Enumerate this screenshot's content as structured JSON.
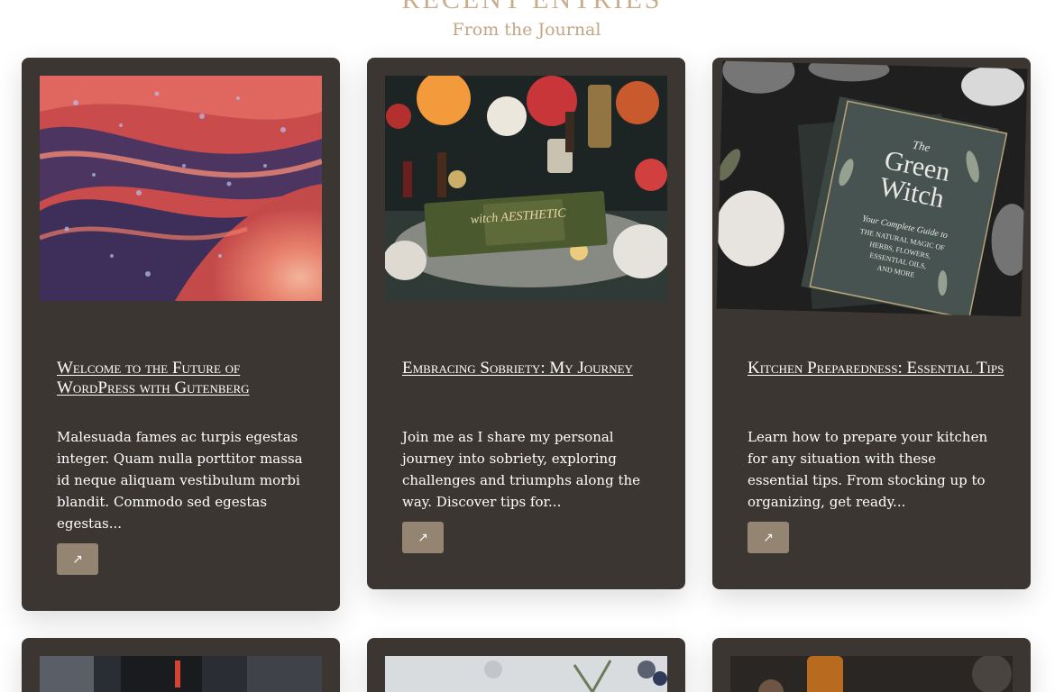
{
  "section": {
    "title": "RECENT ENTRIES",
    "subtitle": "From the Journal"
  },
  "posts": [
    {
      "title": "Welcome to the Future of WordPress with Gutenberg",
      "excerpt": "Malesuada fames ac turpis egestas integer. Quam nulla porttitor massa id neque aliquam vestibulum morbi blandit. Commodo sed egestas egestas...",
      "button_icon": "↗",
      "image": "abstract-fluid-paint-art"
    },
    {
      "title": "Embracing Sobriety: My Journey",
      "excerpt": "Join me as I share my personal journey into sobriety, exploring challenges and triumphs along the way. Discover tips for...",
      "button_icon": "↗",
      "image": "witch-altar-with-candles",
      "image_text": "witch AESTHETIC"
    },
    {
      "title": "Kitchen Preparedness: Essential Tips",
      "excerpt": "Learn how to prepare your kitchen for any situation with these essential tips. From stocking up to organizing, get ready...",
      "button_icon": "↗",
      "image": "green-witch-book",
      "image_text": {
        "line1": "The",
        "line2": "Green",
        "line3": "Witch",
        "line4": "Your Complete Guide to",
        "line5": "THE NATURAL MAGIC OF",
        "line6": "HERBS, FLOWERS,",
        "line7": "ESSENTIAL OILS,",
        "line8": "AND MORE"
      }
    }
  ],
  "colors": {
    "card_bg": "#3b3632",
    "accent_button": "#948472",
    "heading_tan": "#c9ad8c"
  }
}
